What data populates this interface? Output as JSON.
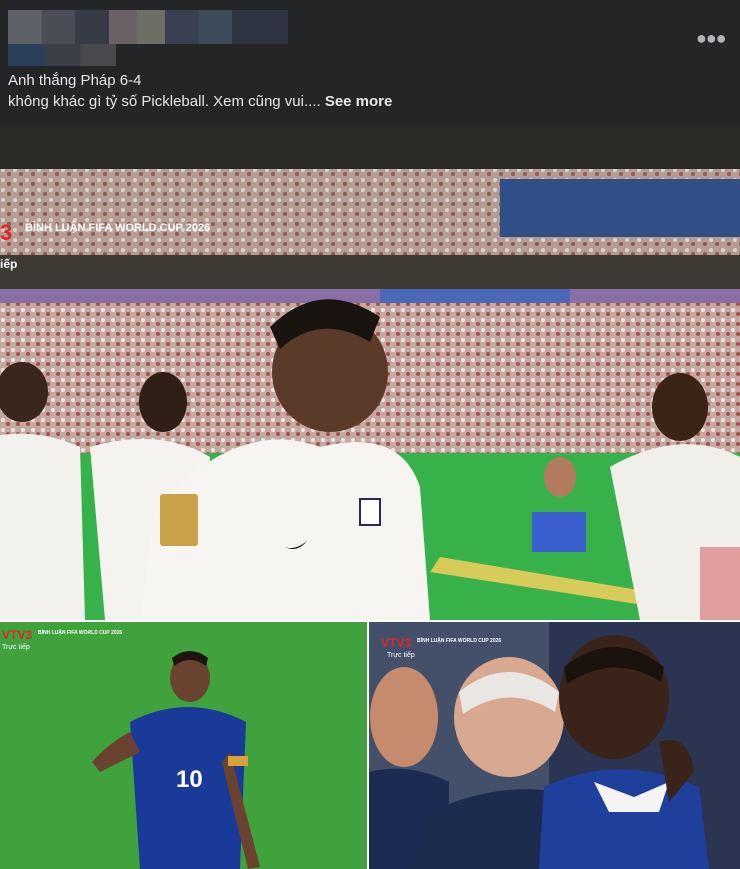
{
  "post": {
    "caption_line1": "Anh thắng Pháp 6-4",
    "caption_line2": "không khác gì tỷ số Pickleball. Xem cũng vui....",
    "see_more_label": "See more",
    "more_icon": "more-horizontal-icon"
  },
  "photos": {
    "main": {
      "logo": "3",
      "broadcast_title": "BÌNH LUẬN FIFA WORLD CUP 2026",
      "live_label": "iếp"
    },
    "left": {
      "logo": "VTV3",
      "broadcast_title": "BÌNH LUẬN FIFA WORLD CUP 2026",
      "live_label": "Trực tiếp",
      "jersey_number": "10"
    },
    "right": {
      "logo": "VTV3",
      "broadcast_title": "BÌNH LUẬN FIFA WORLD CUP 2026",
      "live_label": "Trực tiếp"
    }
  }
}
